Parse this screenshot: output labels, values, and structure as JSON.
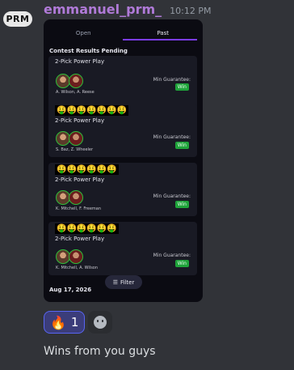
{
  "author": {
    "avatar_text": "PRM",
    "username": "emmanuel_prm_",
    "timestamp": "10:12 PM"
  },
  "embed": {
    "tabs": [
      "Open",
      "Past"
    ],
    "active_tab": "Past",
    "section_title": "Contest Results Pending",
    "cards": [
      {
        "emojis": "",
        "title": "2-Pick Power Play",
        "players": "A. Wilson, A. Reese",
        "min_label": "Min Guarantee:",
        "result": "Win"
      },
      {
        "emojis": "🤑🤑🤑🤑🤑🤑🤑",
        "title": "2-Pick Power Play",
        "players": "S. Baz, Z. Wheeler",
        "min_label": "Min Guarantee:",
        "result": "Win"
      },
      {
        "emojis": "🤑🤑🤑🤑🤑🤑",
        "title": "2-Pick Power Play",
        "players": "K. Mitchell, F. Freeman",
        "min_label": "Min Guarantee:",
        "result": "Win"
      },
      {
        "emojis": "🤑🤑🤑🤑🤑🤑",
        "title": "2-Pick Power Play",
        "players": "K. Mitchell, A. Wilson",
        "min_label": "Min Guarantee:",
        "result": "Win"
      }
    ],
    "filter_label": "Filter",
    "date_label": "Aug 17, 2026"
  },
  "reactions": [
    {
      "emoji": "🔥",
      "count": "1",
      "icon": "fire-icon"
    }
  ],
  "add_reaction_icon": "smiley-icon",
  "message_text": "Wins from you guys",
  "colors": {
    "username": "#b07ad8",
    "tab_accent": "#7b3cf0",
    "win_badge": "#1fa33a",
    "reaction_active": "#5865f2"
  }
}
